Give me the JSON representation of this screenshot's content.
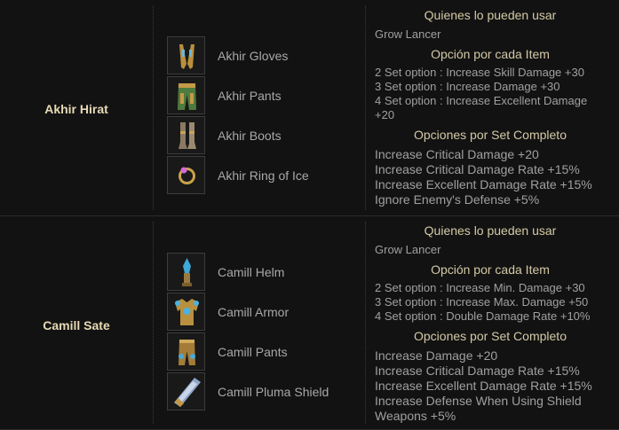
{
  "sets": [
    {
      "name": "Akhir Hirat",
      "items": [
        {
          "name": "Akhir Gloves",
          "icon": "gloves-icon"
        },
        {
          "name": "Akhir Pants",
          "icon": "pants-icon"
        },
        {
          "name": "Akhir Boots",
          "icon": "boots-icon"
        },
        {
          "name": "Akhir Ring of Ice",
          "icon": "ring-icon"
        }
      ],
      "users_header": "Quienes lo pueden usar",
      "users": "Grow Lancer",
      "item_option_header": "Opción por cada Item",
      "item_options": [
        "2 Set option : Increase Skill Damage +30",
        "3 Set option : Increase Damage +30",
        "4 Set option : Increase Excellent Damage",
        "+20"
      ],
      "full_set_header": "Opciones por Set Completo",
      "full_set_options": [
        "Increase Critical Damage +20",
        "Increase Critical Damage Rate +15%",
        "Increase Excellent Damage Rate +15%",
        "Ignore Enemy's Defense +5%"
      ]
    },
    {
      "name": "Camill Sate",
      "items": [
        {
          "name": "Camill Helm",
          "icon": "helm-icon"
        },
        {
          "name": "Camill Armor",
          "icon": "armor-icon"
        },
        {
          "name": "Camill Pants",
          "icon": "pants-icon"
        },
        {
          "name": "Camill Pluma Shield",
          "icon": "shield-icon"
        }
      ],
      "users_header": "Quienes lo pueden usar",
      "users": "Grow Lancer",
      "item_option_header": "Opción por cada Item",
      "item_options": [
        "2 Set option : Increase Min. Damage +30",
        "3 Set option : Increase Max. Damage +50",
        "4 Set option : Double Damage Rate +10%"
      ],
      "full_set_header": "Opciones por Set Completo",
      "full_set_options": [
        "Increase Damage +20",
        "Increase Critical Damage Rate +15%",
        "Increase Excellent Damage Rate +15%",
        "Increase Defense When Using Shield",
        "Weapons +5%"
      ]
    }
  ]
}
